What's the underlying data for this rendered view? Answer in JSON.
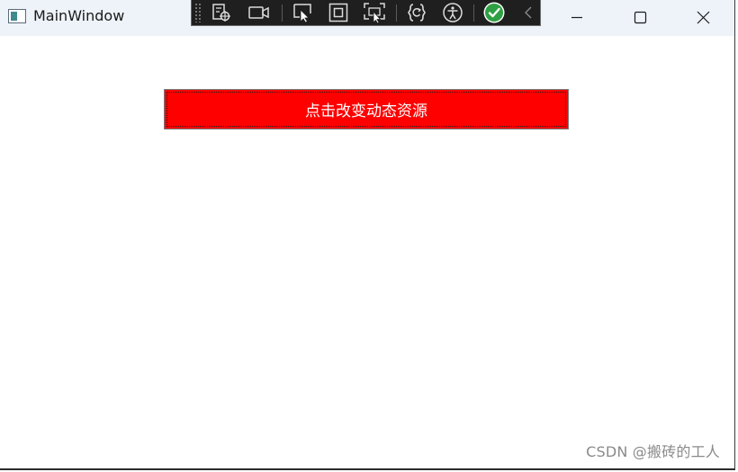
{
  "window": {
    "title": "MainWindow",
    "icon": "app-window-icon",
    "controls": {
      "minimize_icon": "minimize-icon",
      "maximize_icon": "maximize-icon",
      "close_icon": "close-icon"
    }
  },
  "debug_toolbar": {
    "tools": [
      {
        "name": "go-to-live-visual-tree-icon"
      },
      {
        "name": "record-icon"
      },
      {
        "name": "select-element-icon"
      },
      {
        "name": "display-layout-adorners-icon"
      },
      {
        "name": "track-focused-element-icon"
      },
      {
        "name": "hot-reload-icon"
      },
      {
        "name": "accessibility-icon"
      },
      {
        "name": "binding-check-icon"
      },
      {
        "name": "collapse-chevron-icon"
      }
    ],
    "accent_check_color": "#2ea043"
  },
  "content": {
    "button_label": "点击改变动态资源",
    "button_color": "#ff0000",
    "button_text_color": "#ffffff"
  },
  "watermark": "CSDN @搬砖的工人"
}
